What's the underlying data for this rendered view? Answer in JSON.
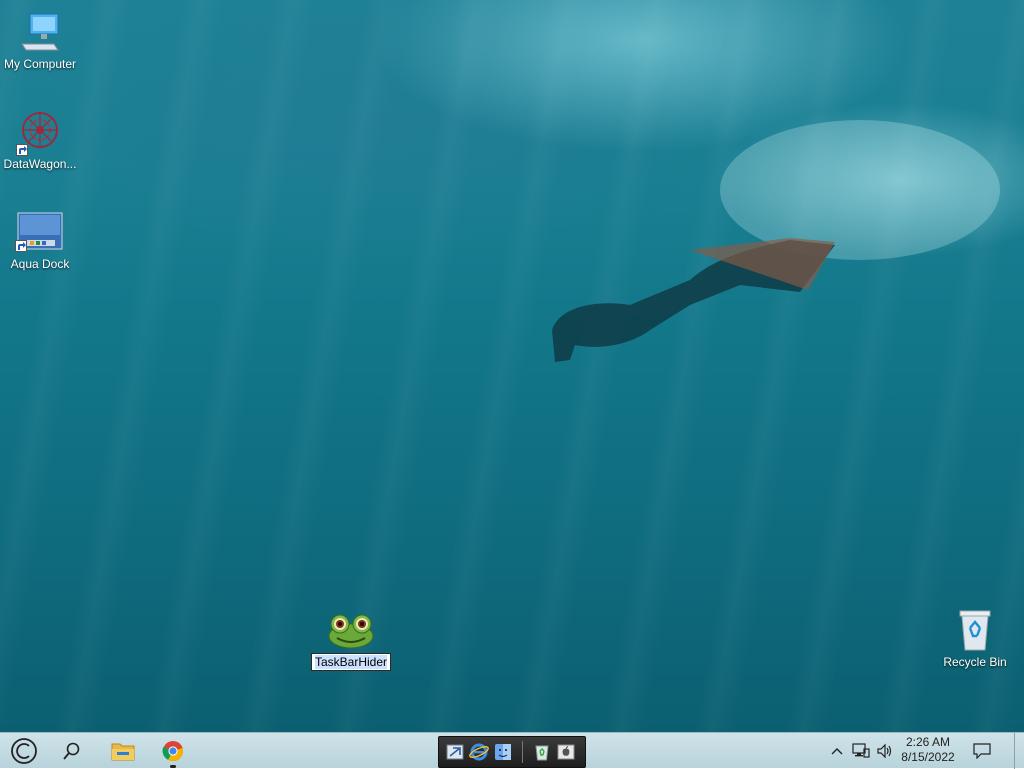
{
  "desktop": {
    "icons": [
      {
        "id": "my-computer",
        "label": "My Computer"
      },
      {
        "id": "datawagon",
        "label": "DataWagon..."
      },
      {
        "id": "aqua-dock",
        "label": "Aqua Dock"
      },
      {
        "id": "taskbarhider",
        "label": "TaskBarHider"
      },
      {
        "id": "recycle-bin",
        "label": "Recycle Bin"
      }
    ]
  },
  "taskbar": {
    "clock": {
      "time": "2:26 AM",
      "date": "8/15/2022"
    },
    "buttons": [
      "start-icon",
      "search-icon",
      "file-explorer-icon",
      "chrome-icon"
    ],
    "dock_items": [
      "mail-icon",
      "internet-explorer-icon",
      "finder-icon",
      "recycle-icon",
      "apple-icon"
    ],
    "tray": [
      "chevron-up-icon",
      "network-icon",
      "volume-icon",
      "notification-icon"
    ]
  },
  "colors": {
    "taskbar_bg": "#c3dbe2",
    "water_top": "#1f8196",
    "water_bottom": "#0b5f70",
    "rename_highlight": "#cce0ff"
  }
}
